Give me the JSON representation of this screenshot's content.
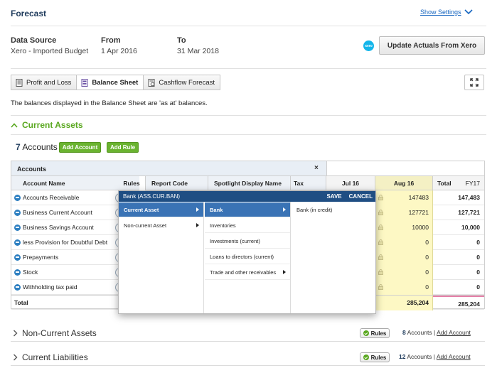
{
  "header": {
    "title": "Forecast",
    "show_settings": "Show Settings"
  },
  "meta": {
    "data_source_label": "Data Source",
    "data_source_value": "Xero - Imported Budget",
    "from_label": "From",
    "from_value": "1 Apr 2016",
    "to_label": "To",
    "to_value": "31 Mar 2018",
    "xero_logo_text": "xero",
    "update_button": "Update Actuals From Xero"
  },
  "tabs": [
    {
      "label": "Profit and Loss",
      "icon": "document-icon"
    },
    {
      "label": "Balance Sheet",
      "icon": "balance-sheet-icon",
      "active": true
    },
    {
      "label": "Cashflow Forecast",
      "icon": "cashflow-icon"
    }
  ],
  "note": "The balances displayed in the Balance Sheet are 'as at' balances.",
  "current_assets": {
    "title": "Current Assets",
    "count": "7",
    "accounts_word": "Accounts",
    "add_account": "Add Account",
    "add_rule": "Add Rule"
  },
  "grid": {
    "group_header": "Accounts",
    "close": "×",
    "columns": {
      "account_name": "Account Name",
      "rules": "Rules",
      "report_code": "Report Code",
      "spotlight": "Spotlight Display Name",
      "tax": "Tax",
      "jul": "Jul 16",
      "aug": "Aug 16",
      "total": "Total",
      "fy": "FY17"
    },
    "rows": [
      {
        "name": "Accounts Receivable",
        "aug": "147483",
        "total": "147,483"
      },
      {
        "name": "Business Current Account",
        "aug": "127721",
        "total": "127,721"
      },
      {
        "name": "Business Savings Account",
        "aug": "10000",
        "total": "10,000"
      },
      {
        "name": "less Provision for Doubtful Debt",
        "aug": "0",
        "total": "0"
      },
      {
        "name": "Prepayments",
        "aug": "0",
        "total": "0"
      },
      {
        "name": "Stock",
        "aug": "0",
        "total": "0"
      },
      {
        "name": "Withholding tax paid",
        "aug": "0",
        "total": "0"
      }
    ],
    "total_row": {
      "name": "Total",
      "aug": "285,204",
      "total": "285,204"
    }
  },
  "popup": {
    "title": "Bank (ASS.CUR.BAN)",
    "save": "SAVE",
    "cancel": "CANCEL",
    "col1": [
      "Current Asset",
      "Non-current Asset"
    ],
    "col2": [
      "Bank",
      "Inventories",
      "Investments (current)",
      "Loans to directors (current)",
      "Trade and other receivables"
    ],
    "col3": [
      "Bank (in credit)"
    ]
  },
  "sections": [
    {
      "title": "Non-Current Assets",
      "rules": "Rules",
      "count": "8",
      "accounts_word": "Accounts",
      "add_account": "Add Account"
    },
    {
      "title": "Current Liabilities",
      "rules": "Rules",
      "count": "12",
      "accounts_word": "Accounts",
      "add_account": "Add Account"
    }
  ]
}
